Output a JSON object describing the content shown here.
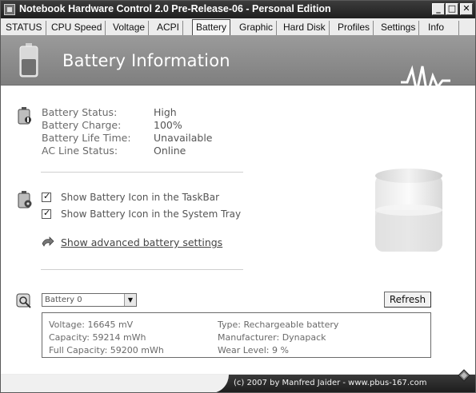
{
  "window": {
    "title": "Notebook Hardware Control 2.0 Pre-Release-06 - Personal Edition",
    "minimize_glyph": "_",
    "maximize_glyph": "□",
    "close_glyph": "✕"
  },
  "tabs": [
    {
      "label": "STATUS"
    },
    {
      "label": "CPU Speed"
    },
    {
      "label": "Voltage"
    },
    {
      "label": "ACPI"
    },
    {
      "label": "Battery",
      "active": true
    },
    {
      "label": "Graphic"
    },
    {
      "label": "Hard Disk"
    },
    {
      "label": "Profiles"
    },
    {
      "label": "Settings"
    },
    {
      "label": "Info"
    }
  ],
  "header": {
    "title": "Battery Information"
  },
  "status": {
    "battery_status_label": "Battery Status:",
    "battery_status_value": "High",
    "battery_charge_label": "Battery Charge:",
    "battery_charge_value": "100%",
    "battery_life_label": "Battery Life Time:",
    "battery_life_value": "Unavailable",
    "ac_line_label": "AC Line Status:",
    "ac_line_value": "Online"
  },
  "options": {
    "taskbar_label": "Show Battery Icon in the TaskBar",
    "taskbar_checked": true,
    "tray_label": "Show Battery Icon in the System Tray",
    "tray_checked": true,
    "advanced_link": "Show advanced battery settings"
  },
  "battery_select": {
    "selected": "Battery 0"
  },
  "refresh_label": "Refresh",
  "details": {
    "voltage": "Voltage:  16645 mV",
    "capacity": "Capacity:  59214 mWh",
    "full_capacity": "Full Capacity:  59200 mWh",
    "type": "Type:  Rechargeable battery",
    "manufacturer": "Manufacturer:  Dynapack",
    "wear_level": "Wear Level:  9 %"
  },
  "footer": {
    "text": "(c) 2007 by Manfred Jaider - www.pbus-167.com"
  },
  "colors": {
    "title_bar": "#2a2a2a",
    "banner": "#8c8c8c",
    "content_bg": "#ffffff"
  }
}
